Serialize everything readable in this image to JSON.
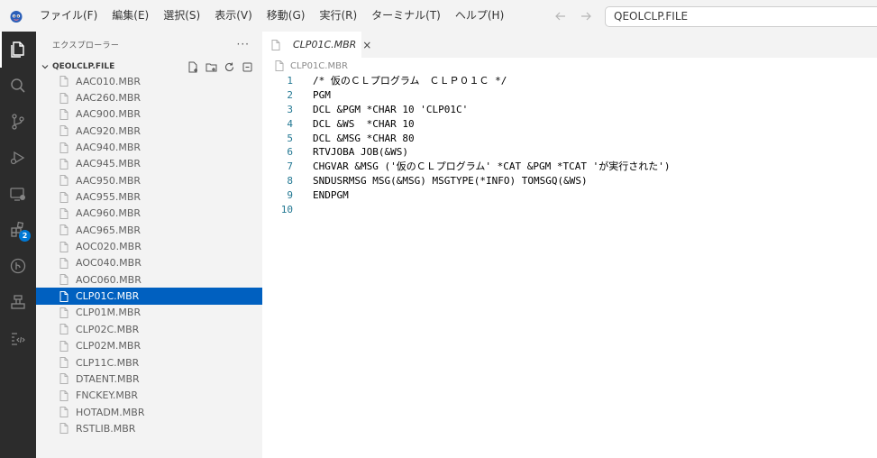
{
  "menu": {
    "items": [
      "ファイル(F)",
      "編集(E)",
      "選択(S)",
      "表示(V)",
      "移動(G)",
      "実行(R)",
      "ターミナル(T)",
      "ヘルプ(H)"
    ]
  },
  "search": {
    "text": "QEOLCLP.FILE"
  },
  "activity": {
    "extensions_badge": "2"
  },
  "sidebar": {
    "title": "エクスプローラー",
    "ellipsis": "···",
    "folder": "QEOLCLP.FILE",
    "files": [
      "AAC010.MBR",
      "AAC260.MBR",
      "AAC900.MBR",
      "AAC920.MBR",
      "AAC940.MBR",
      "AAC945.MBR",
      "AAC950.MBR",
      "AAC955.MBR",
      "AAC960.MBR",
      "AAC965.MBR",
      "AOC020.MBR",
      "AOC040.MBR",
      "AOC060.MBR",
      "CLP01C.MBR",
      "CLP01M.MBR",
      "CLP02C.MBR",
      "CLP02M.MBR",
      "CLP11C.MBR",
      "DTAENT.MBR",
      "FNCKEY.MBR",
      "HOTADM.MBR",
      "RSTLIB.MBR"
    ],
    "selected_index": 13
  },
  "editor": {
    "tab_label": "CLP01C.MBR",
    "tab_close": "×",
    "breadcrumb": "CLP01C.MBR",
    "lines": [
      "/* 仮のＣＬプログラム　ＣＬＰ０１Ｃ */",
      "PGM",
      "DCL &PGM *CHAR 10 'CLP01C'",
      "DCL &WS  *CHAR 10",
      "DCL &MSG *CHAR 80",
      "RTVJOBA JOB(&WS)",
      "CHGVAR &MSG ('仮のＣＬプログラム' *CAT &PGM *TCAT 'が実行された')",
      "SNDUSRMSG MSG(&MSG) MSGTYPE(*INFO) TOMSGQ(&WS)",
      "ENDPGM",
      ""
    ]
  },
  "colors": {
    "activity_bar": "#2c2c2c",
    "sidebar": "#f3f3f3",
    "selection": "#0060c0",
    "line_number": "#237893",
    "badge": "#0078d4"
  }
}
